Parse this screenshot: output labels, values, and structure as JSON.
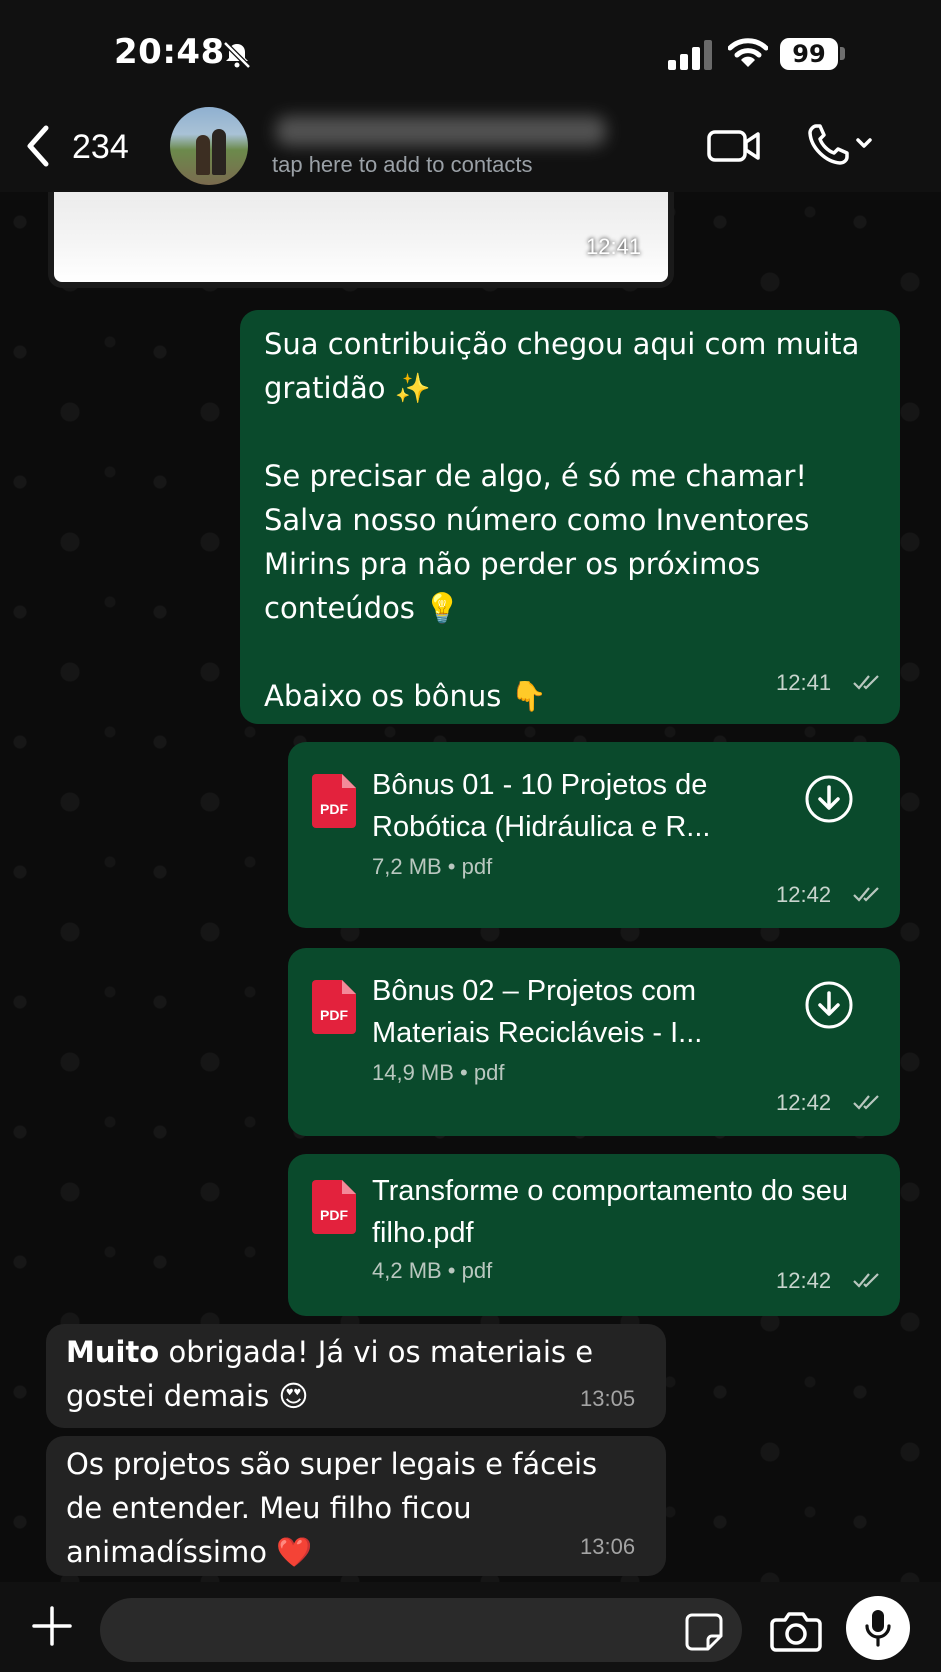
{
  "status_bar": {
    "time": "20:48",
    "battery": "99"
  },
  "header": {
    "back_count": "234",
    "subtitle": "tap here to add to contacts"
  },
  "messages": {
    "top_card_time": "12:41",
    "msg1": {
      "text": "Sua contribuição chegou aqui com muita\ngratidão ✨\n\nSe precisar de algo, é só me chamar!\nSalva nosso número como Inventores\nMirins pra não perder os próximos\nconteúdos 💡\n\nAbaixo os bônus 👇",
      "time": "12:41"
    },
    "doc1": {
      "badge": "PDF",
      "title": "Bônus 01 - 10 Projetos de Robótica (Hidráulica e R...",
      "meta": "7,2 MB • pdf",
      "time": "12:42"
    },
    "doc2": {
      "badge": "PDF",
      "title": "Bônus 02 – Projetos com Materiais Recicláveis - I...",
      "meta": "14,9 MB • pdf",
      "time": "12:42"
    },
    "doc3": {
      "badge": "PDF",
      "title": "Transforme o comportamento do seu filho.pdf",
      "meta": "4,2 MB • pdf",
      "time": "12:42"
    },
    "in1": {
      "bold": "Muito",
      "text": " obrigada! Já vi os materiais e\ngostei demais 😍",
      "time": "13:05"
    },
    "in2": {
      "text": "Os projetos são super legais e fáceis\nde entender. Meu filho ficou\nanimadíssimo ❤️",
      "time": "13:06"
    }
  },
  "composer": {
    "placeholder": ""
  },
  "colors": {
    "outgoing_bubble": "#0a4a2c",
    "incoming_bubble": "#232323",
    "pdf_red": "#e3223d"
  }
}
